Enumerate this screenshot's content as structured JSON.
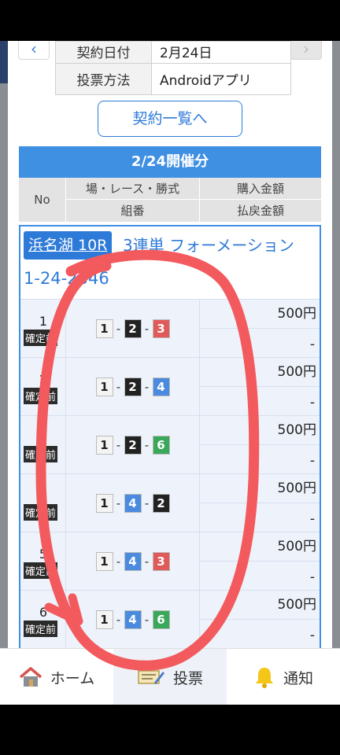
{
  "info": {
    "date_key": "契約日付",
    "date_val": "2月24日",
    "method_key": "投票方法",
    "method_val": "Androidアプリ"
  },
  "nav": {
    "prev": "‹",
    "next": "›"
  },
  "list_button": "契約一覧へ",
  "day_header": "2/24開催分",
  "columns": {
    "no": "No",
    "venue": "場・レース・勝式",
    "purchase": "購入金額",
    "combo": "組番",
    "payout": "払戻金額"
  },
  "ticket": {
    "race": "浜名湖 10R",
    "type": "3連単 フォーメーション",
    "combination": "1-24-2346"
  },
  "rows": [
    {
      "no": "1",
      "status": "確定前",
      "b1": "1",
      "b2": "2",
      "b3": "3",
      "amount": "500円",
      "payout": "-"
    },
    {
      "no": "2",
      "status": "確定前",
      "b1": "1",
      "b2": "2",
      "b3": "4",
      "amount": "500円",
      "payout": "-"
    },
    {
      "no": "3",
      "status": "確定前",
      "b1": "1",
      "b2": "2",
      "b3": "6",
      "amount": "500円",
      "payout": "-"
    },
    {
      "no": "4",
      "status": "確定前",
      "b1": "1",
      "b2": "4",
      "b3": "2",
      "amount": "500円",
      "payout": "-"
    },
    {
      "no": "5",
      "status": "確定前",
      "b1": "1",
      "b2": "4",
      "b3": "3",
      "amount": "500円",
      "payout": "-"
    },
    {
      "no": "6",
      "status": "確定前",
      "b1": "1",
      "b2": "4",
      "b3": "6",
      "amount": "500円",
      "payout": "-"
    }
  ],
  "boat_colors": {
    "1": {
      "bg": "#f4f4f4",
      "fg": "#222"
    },
    "2": {
      "bg": "#222222",
      "fg": "#ffffff"
    },
    "3": {
      "bg": "#e05a5a",
      "fg": "#ffffff"
    },
    "4": {
      "bg": "#4a8be0",
      "fg": "#ffffff"
    },
    "6": {
      "bg": "#3aa85a",
      "fg": "#ffffff"
    }
  },
  "tabs": {
    "home": "ホーム",
    "vote": "投票",
    "notice": "通知"
  },
  "colors": {
    "accent": "#3f8fe3",
    "annotation": "#f25a5e"
  }
}
